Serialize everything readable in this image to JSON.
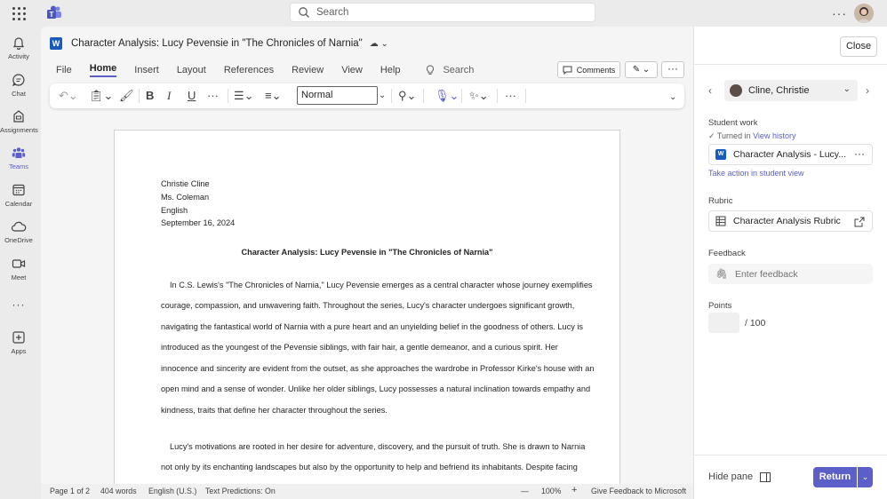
{
  "topbar": {
    "search_placeholder": "Search",
    "more": "···"
  },
  "rail": [
    {
      "label": "Activity",
      "icon": "bell-icon"
    },
    {
      "label": "Chat",
      "icon": "chat-icon"
    },
    {
      "label": "Assignments",
      "icon": "assignments-icon"
    },
    {
      "label": "Teams",
      "icon": "teams-icon",
      "active": true
    },
    {
      "label": "Calendar",
      "icon": "calendar-icon"
    },
    {
      "label": "OneDrive",
      "icon": "cloud-icon"
    },
    {
      "label": "Meet",
      "icon": "video-icon"
    },
    {
      "label": "Apps",
      "icon": "apps-icon"
    }
  ],
  "rail_more": "···",
  "doc": {
    "title": "Character Analysis: Lucy Pevensie in \"The Chronicles of Narnia\"",
    "menu": [
      "File",
      "Home",
      "Insert",
      "Layout",
      "References",
      "Review",
      "View",
      "Help"
    ],
    "active_menu": "Home",
    "menu_search": "Search",
    "comments_label": "Comments",
    "style_value": "Normal"
  },
  "page": {
    "header_lines": [
      "Christie Cline",
      "Ms. Coleman",
      "English",
      "September 16, 2024"
    ],
    "heading": "Character Analysis: Lucy Pevensie in \"The Chronicles of Narnia\"",
    "para1": [
      "In C.S. Lewis's \"The Chronicles of Narnia,\" Lucy Pevensie emerges as a central character whose journey exemplifies",
      "courage, compassion, and unwavering faith. Throughout the series, Lucy's character undergoes significant growth,",
      "navigating the fantastical world of Narnia with a pure heart and an unyielding belief in the goodness of others. Lucy is",
      "introduced as the youngest of the Pevensie siblings, with fair hair, a gentle demeanor, and a curious spirit. Her",
      "innocence and sincerity are evident from the outset, as she approaches the wardrobe in Professor Kirke's house with an",
      "open mind and a sense of wonder. Unlike her older siblings, Lucy possesses a natural inclination towards empathy and",
      "kindness, traits that define her character throughout the series."
    ],
    "para2": [
      "Lucy's motivations are rooted in her desire for adventure, discovery, and the pursuit of truth. She is drawn to Narnia",
      "not only by its enchanting landscapes but also by the opportunity to help and befriend its inhabitants. Despite facing"
    ]
  },
  "status": {
    "page": "Page 1 of 2",
    "words": "404 words",
    "language": "English (U.S.)",
    "predictions": "Text Predictions: On",
    "zoom_minus": "—",
    "zoom": "100%",
    "zoom_plus": "+",
    "feedback": "Give Feedback to Microsoft"
  },
  "pane": {
    "close_label": "Close",
    "student_name": "Cline, Christie",
    "student_work_label": "Student work",
    "turned_in": "Turned in",
    "view_history": "View history",
    "file_name": "Character Analysis - Lucy...",
    "take_action": "Take action in student view",
    "rubric_label": "Rubric",
    "rubric_name": "Character Analysis Rubric",
    "feedback_label": "Feedback",
    "feedback_placeholder": "Enter feedback",
    "points_label": "Points",
    "points_total": "/ 100",
    "hide_pane": "Hide pane",
    "return_label": "Return"
  },
  "colors": {
    "accent": "#5b5fc7",
    "word_blue": "#185abd"
  }
}
